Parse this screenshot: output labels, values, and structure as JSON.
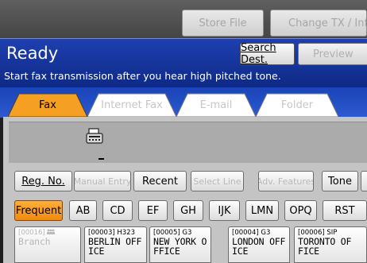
{
  "toolbar": {
    "store_file": "Store File",
    "change_tx": "Change TX / Info"
  },
  "status": {
    "title": "Ready",
    "message": "Start fax transmission after you hear high pitched tone.",
    "search_dest": "Search Dest.",
    "preview": "Preview"
  },
  "tabs": [
    "Fax",
    "Internet Fax",
    "E-mail",
    "Folder"
  ],
  "controls": {
    "reg_no": "Reg. No.",
    "manual_entry": "Manual Entry",
    "recent": "Recent",
    "select_line": "Select Line",
    "adv_features": "Adv. Features",
    "tone": "Tone"
  },
  "index": [
    "Frequent",
    "AB",
    "CD",
    "EF",
    "GH",
    "IJK",
    "LMN",
    "OPQ",
    "RST"
  ],
  "destinations": [
    {
      "code": "[00016]",
      "name": "Branch",
      "disabled": true
    },
    {
      "code": "[00003] H323",
      "name": "BERLIN OFF\nICE"
    },
    {
      "code": "[00005] G3",
      "name": "NEW YORK O\nFFICE"
    },
    {
      "code": "[00004] G3",
      "name": "LONDON OFF\nICE"
    },
    {
      "code": "[00006] SIP",
      "name": "TORONTO OF\nFICE"
    }
  ],
  "colors": {
    "status_blue": "#1e3fb0",
    "selected_orange": "#f59a1e",
    "panel_gray": "#c4c4c4"
  },
  "icons": [
    "fax-machine-icon",
    "group-icon"
  ]
}
